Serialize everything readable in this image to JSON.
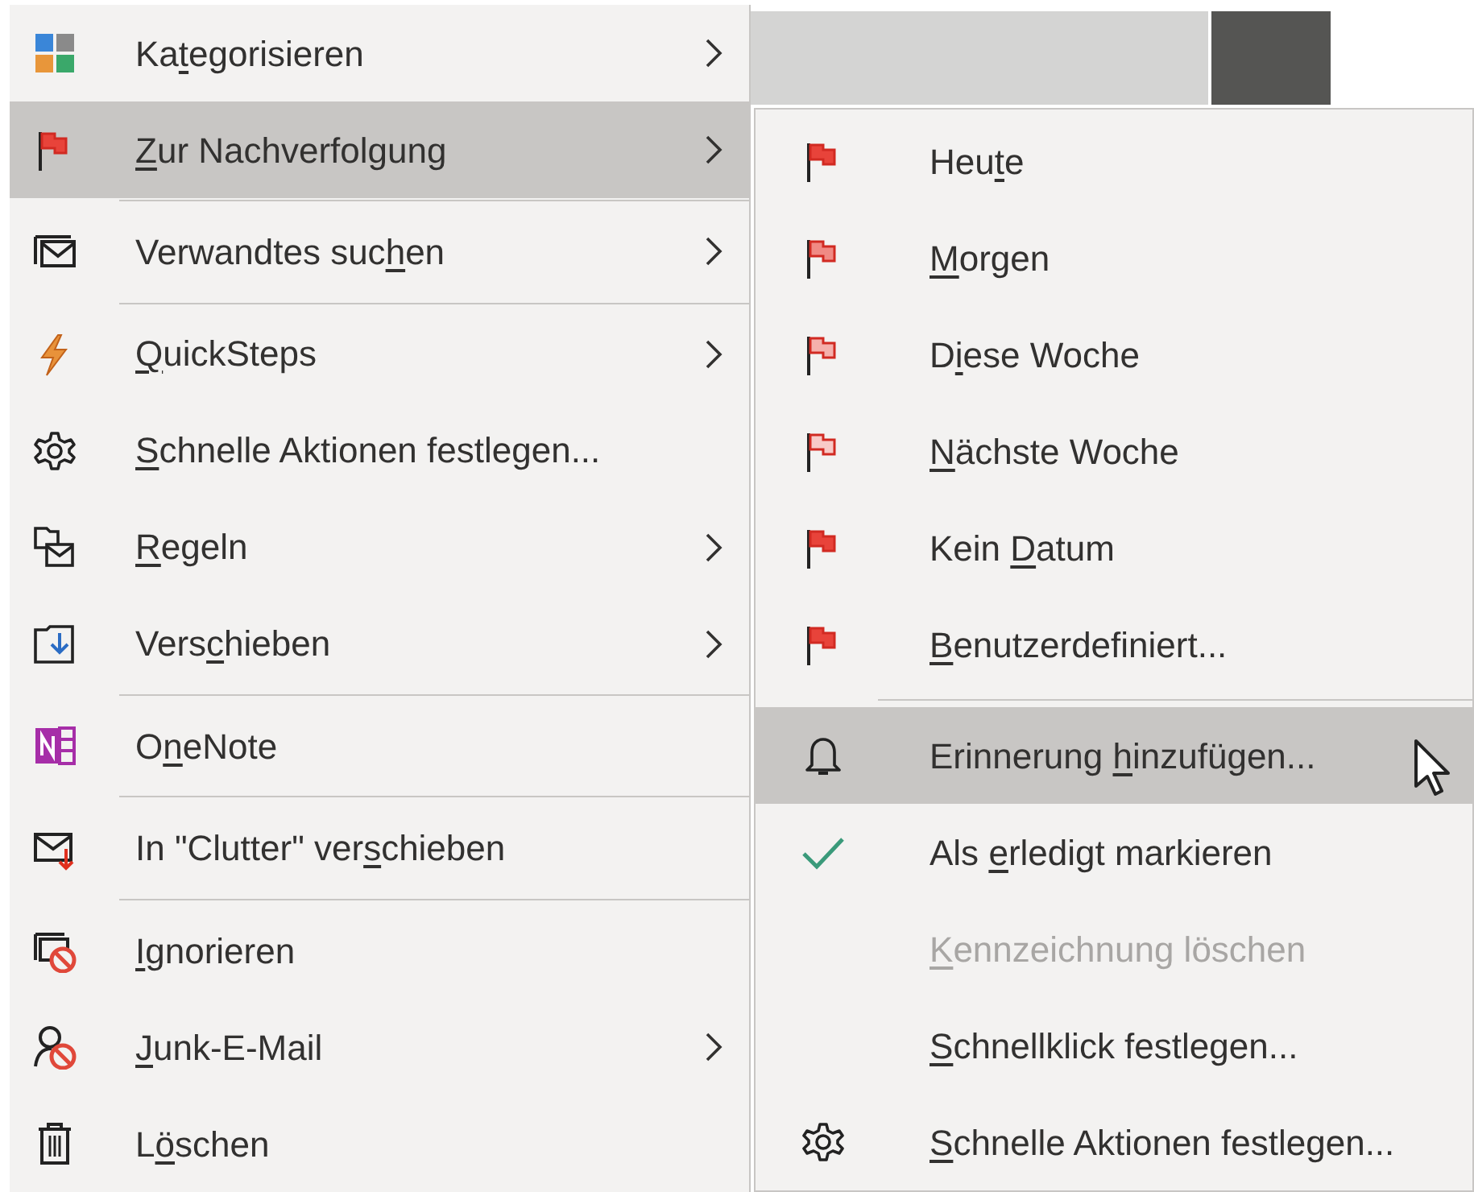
{
  "context_menu": {
    "items": [
      {
        "kind": "item",
        "label": {
          "before": "Ka",
          "key": "t",
          "after": "egorisieren"
        },
        "submenu": true,
        "selected": false
      },
      {
        "kind": "item",
        "color": "#e8433a",
        "label": {
          "key": "Z",
          "after": "ur Nachverfolgung"
        },
        "submenu": true,
        "selected": true
      },
      {
        "kind": "separator"
      },
      {
        "kind": "item",
        "label": {
          "before": "Verwandtes suc",
          "key": "h",
          "after": "en"
        },
        "submenu": true,
        "selected": false
      },
      {
        "kind": "separator"
      },
      {
        "kind": "item",
        "label": {
          "key": "Q",
          "after": "uickSteps"
        },
        "submenu": true,
        "selected": false
      },
      {
        "kind": "item",
        "label": {
          "key": "S",
          "after": "chnelle Aktionen festlegen..."
        },
        "submenu": false,
        "selected": false
      },
      {
        "kind": "item",
        "label": {
          "key": "R",
          "after": "egeln"
        },
        "submenu": true,
        "selected": false
      },
      {
        "kind": "item",
        "label": {
          "before": "Vers",
          "key": "c",
          "after": "hieben"
        },
        "submenu": true,
        "selected": false
      },
      {
        "kind": "separator"
      },
      {
        "kind": "item",
        "label": {
          "before": "O",
          "key": "n",
          "after": "eNote"
        },
        "submenu": false,
        "selected": false
      },
      {
        "kind": "separator"
      },
      {
        "kind": "item",
        "label": {
          "before": "In \"Clutter\" ver",
          "key": "s",
          "after": "chieben"
        },
        "submenu": false,
        "selected": false
      },
      {
        "kind": "separator"
      },
      {
        "kind": "item",
        "label": {
          "key": "I",
          "after": "gnorieren"
        },
        "submenu": false,
        "selected": false
      },
      {
        "kind": "item",
        "label": {
          "key": "J",
          "after": "unk-E-Mail"
        },
        "submenu": true,
        "selected": false
      },
      {
        "kind": "item",
        "label": {
          "before": "L",
          "key": "ö",
          "after": "schen"
        },
        "submenu": false,
        "selected": false
      }
    ]
  },
  "submenu": {
    "items": [
      {
        "kind": "item",
        "color": "#e8433a",
        "label": {
          "before": "Heu",
          "key": "t",
          "after": "e"
        },
        "selected": false,
        "disabled": false
      },
      {
        "kind": "item",
        "color": "#f08a84",
        "label": {
          "key": "M",
          "after": "orgen"
        },
        "selected": false,
        "disabled": false
      },
      {
        "kind": "item",
        "color": "#f5b0ac",
        "label": {
          "before": "D",
          "key": "i",
          "after": "ese Woche"
        },
        "selected": false,
        "disabled": false
      },
      {
        "kind": "item",
        "color": "#f8cac7",
        "label": {
          "key": "N",
          "after": "ächste Woche"
        },
        "selected": false,
        "disabled": false
      },
      {
        "kind": "item",
        "color": "#e8433a",
        "label": {
          "before": "Kein ",
          "key": "D",
          "after": "atum"
        },
        "selected": false,
        "disabled": false
      },
      {
        "kind": "item",
        "color": "#e8433a",
        "label": {
          "key": "B",
          "after": "enutzerdefiniert..."
        },
        "selected": false,
        "disabled": false
      },
      {
        "kind": "separator"
      },
      {
        "kind": "item",
        "label": {
          "before": "Erinnerung ",
          "key": "h",
          "after": "inzufügen..."
        },
        "selected": true,
        "disabled": false
      },
      {
        "kind": "item",
        "label": {
          "before": "Als ",
          "key": "e",
          "after": "rledigt markieren"
        },
        "selected": false,
        "disabled": false
      },
      {
        "kind": "item",
        "label": {
          "key": "K",
          "after": "ennzeichnung löschen"
        },
        "selected": false,
        "disabled": true
      },
      {
        "kind": "item",
        "label": {
          "key": "S",
          "after": "chnellklick festlegen..."
        },
        "selected": false,
        "disabled": false
      },
      {
        "kind": "item",
        "label": {
          "key": "S",
          "after": "chnelle Aktionen festlegen..."
        },
        "selected": false,
        "disabled": false
      }
    ]
  }
}
